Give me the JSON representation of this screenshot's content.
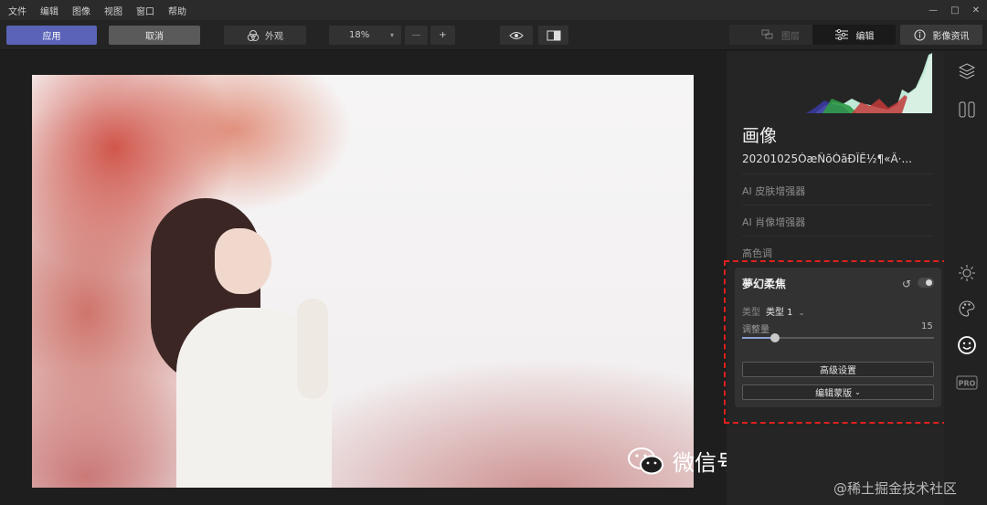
{
  "menu": [
    "文件",
    "编辑",
    "图像",
    "视图",
    "窗口",
    "帮助"
  ],
  "window_controls": {
    "minimize": "—",
    "maximize": "□",
    "close": "✕"
  },
  "toolbar": {
    "apply_label": "应用",
    "cancel_label": "取消",
    "look_label": "外观",
    "zoom_value": "18%",
    "zoom_minus": "—",
    "zoom_plus": "+",
    "layers_label": "图层",
    "edit_label": "编辑",
    "info_label": "影像资讯"
  },
  "panel": {
    "title": "画像",
    "filename": "20201025ÒæÑõÓãÐÎÊ½¶«Â·...",
    "sections": [
      "AI 皮肤增强器",
      "AI 肖像增强器",
      "高色调"
    ]
  },
  "tool_card": {
    "title": "夢幻柔焦",
    "type_label": "类型",
    "type_value": "类型 1",
    "amount_label": "调整量",
    "amount_value": "15",
    "amount_fraction": 0.15,
    "advanced_button": "高级设置",
    "mask_button": "编辑蒙版"
  },
  "icons": [
    "layers-icon",
    "compare-panel-icon",
    "sun-icon",
    "palette-icon",
    "smile-icon",
    "pro-icon"
  ],
  "watermark": {
    "text": "微信号: PHOTOSHOPTEA",
    "credit": "@稀土掘金技术社区"
  },
  "colors": {
    "accent": "#5a63b8",
    "highlight": "#e02020"
  }
}
